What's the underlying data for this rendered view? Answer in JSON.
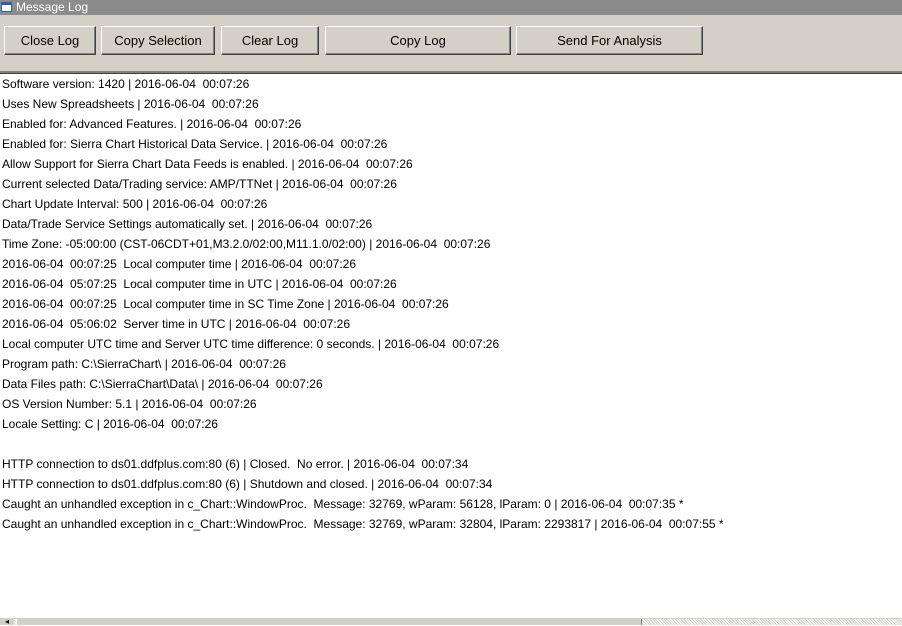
{
  "window": {
    "title": "Message Log"
  },
  "toolbar": {
    "close_log": "Close Log",
    "copy_selection": "Copy Selection",
    "clear_log": "Clear Log",
    "copy_log": "Copy Log",
    "send_for_analysis": "Send For Analysis"
  },
  "log": {
    "lines": [
      "Software version: 1420 | 2016-06-04  00:07:26",
      "Uses New Spreadsheets | 2016-06-04  00:07:26",
      "Enabled for: Advanced Features. | 2016-06-04  00:07:26",
      "Enabled for: Sierra Chart Historical Data Service. | 2016-06-04  00:07:26",
      "Allow Support for Sierra Chart Data Feeds is enabled. | 2016-06-04  00:07:26",
      "Current selected Data/Trading service: AMP/TTNet | 2016-06-04  00:07:26",
      "Chart Update Interval: 500 | 2016-06-04  00:07:26",
      "Data/Trade Service Settings automatically set. | 2016-06-04  00:07:26",
      "Time Zone: -05:00:00 (CST-06CDT+01,M3.2.0/02:00,M11.1.0/02:00) | 2016-06-04  00:07:26",
      "2016-06-04  00:07:25  Local computer time | 2016-06-04  00:07:26",
      "2016-06-04  05:07:25  Local computer time in UTC | 2016-06-04  00:07:26",
      "2016-06-04  00:07:25  Local computer time in SC Time Zone | 2016-06-04  00:07:26",
      "2016-06-04  05:06:02  Server time in UTC | 2016-06-04  00:07:26",
      "Local computer UTC time and Server UTC time difference: 0 seconds. | 2016-06-04  00:07:26",
      "Program path: C:\\SierraChart\\ | 2016-06-04  00:07:26",
      "Data Files path: C:\\SierraChart\\Data\\ | 2016-06-04  00:07:26",
      "OS Version Number: 5.1 | 2016-06-04  00:07:26",
      "Locale Setting: C | 2016-06-04  00:07:26",
      "",
      "HTTP connection to ds01.ddfplus.com:80 (6) | Closed.  No error. | 2016-06-04  00:07:34",
      "HTTP connection to ds01.ddfplus.com:80 (6) | Shutdown and closed. | 2016-06-04  00:07:34",
      "Caught an unhandled exception in c_Chart::WindowProc.  Message: 32769, wParam: 56128, lParam: 0 | 2016-06-04  00:07:35 *",
      "Caught an unhandled exception in c_Chart::WindowProc.  Message: 32769, wParam: 32804, lParam: 2293817 | 2016-06-04  00:07:55 *"
    ]
  },
  "scrollbar": {
    "left_arrow": "◂"
  },
  "colors": {
    "toolbar_bg": "#d4d0c8",
    "titlebar_bg": "#8c8c8c"
  }
}
